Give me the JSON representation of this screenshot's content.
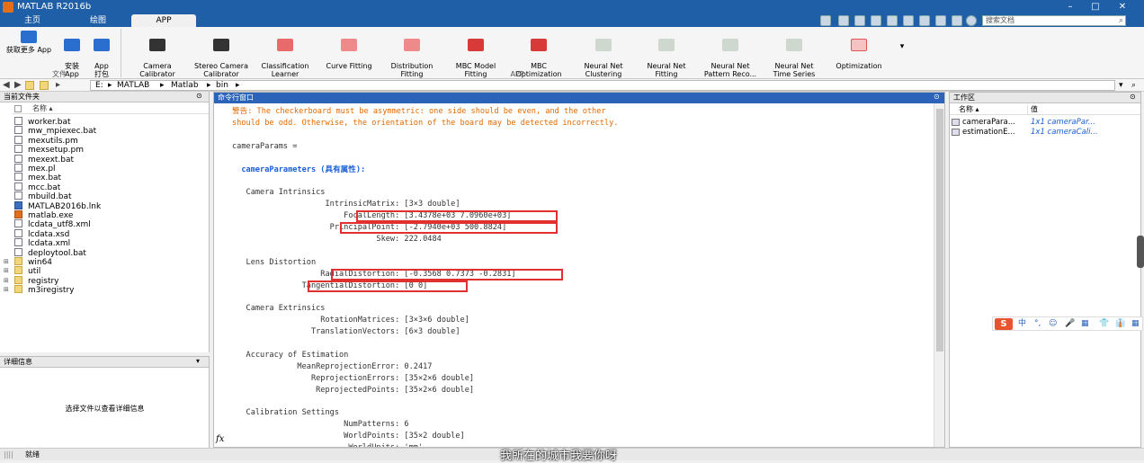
{
  "window": {
    "title": "MATLAB R2016b",
    "controls": [
      "–",
      "□",
      "✕"
    ]
  },
  "tabs": [
    {
      "label": "主页"
    },
    {
      "label": "绘图"
    },
    {
      "label": "APP"
    }
  ],
  "search": {
    "placeholder": "搜索文档"
  },
  "ribbon": {
    "file_group_label": "文件",
    "app_group_label": "APP",
    "file_buttons": [
      {
        "label": "获取更多 App"
      },
      {
        "label": "安装\nApp"
      },
      {
        "label": "App\n打包"
      }
    ],
    "apps": [
      {
        "label": "Camera\nCalibrator"
      },
      {
        "label": "Stereo Camera\nCalibrator"
      },
      {
        "label": "Classification\nLearner"
      },
      {
        "label": "Curve Fitting"
      },
      {
        "label": "Distribution\nFitting"
      },
      {
        "label": "MBC Model\nFitting"
      },
      {
        "label": "MBC\nOptimization"
      },
      {
        "label": "Neural Net\nClustering"
      },
      {
        "label": "Neural Net\nFitting"
      },
      {
        "label": "Neural Net\nPattern Reco..."
      },
      {
        "label": "Neural Net\nTime Series"
      },
      {
        "label": "Optimization"
      }
    ]
  },
  "address": {
    "path": [
      "E:",
      "MATLAB",
      "Matlab",
      "bin"
    ]
  },
  "current_folder": {
    "title": "当前文件夹",
    "col_name": "名称 ▴",
    "files": [
      {
        "name": "worker.bat",
        "type": "file"
      },
      {
        "name": "mw_mpiexec.bat",
        "type": "file"
      },
      {
        "name": "mexutils.pm",
        "type": "file"
      },
      {
        "name": "mexsetup.pm",
        "type": "file"
      },
      {
        "name": "mexext.bat",
        "type": "file"
      },
      {
        "name": "mex.pl",
        "type": "file"
      },
      {
        "name": "mex.bat",
        "type": "file"
      },
      {
        "name": "mcc.bat",
        "type": "file"
      },
      {
        "name": "mbuild.bat",
        "type": "file"
      },
      {
        "name": "MATLAB2016b.lnk",
        "type": "exe"
      },
      {
        "name": "matlab.exe",
        "type": "mat"
      },
      {
        "name": "lcdata_utf8.xml",
        "type": "file"
      },
      {
        "name": "lcdata.xsd",
        "type": "file"
      },
      {
        "name": "lcdata.xml",
        "type": "file"
      },
      {
        "name": "deploytool.bat",
        "type": "file"
      },
      {
        "name": "win64",
        "type": "folder"
      },
      {
        "name": "util",
        "type": "folder"
      },
      {
        "name": "registry",
        "type": "folder"
      },
      {
        "name": "m3iregistry",
        "type": "folder"
      }
    ]
  },
  "details": {
    "title": "详细信息",
    "message": "选择文件以查看详细信息"
  },
  "command_window": {
    "title": "命令行窗口",
    "lines": [
      {
        "text": "警告: The checkerboard must be asymmetric: one side should be even, and the other",
        "style": "warn"
      },
      {
        "text": "should be odd. Otherwise, the orientation of the board may be detected incorrectly.",
        "style": "warn"
      },
      {
        "text": "",
        "style": ""
      },
      {
        "text": "cameraParams =",
        "style": ""
      },
      {
        "text": "",
        "style": ""
      },
      {
        "text": "  cameraParameters (具有属性):",
        "style": "link"
      },
      {
        "text": "",
        "style": ""
      },
      {
        "text": "   Camera Intrinsics",
        "style": ""
      },
      {
        "text": "                    IntrinsicMatrix: [3×3 double]",
        "style": ""
      },
      {
        "text": "                        FocalLength: [3.4378e+03 7.0960e+03]",
        "style": ""
      },
      {
        "text": "                     PrincipalPoint: [-2.7940e+03 500.8824]",
        "style": ""
      },
      {
        "text": "                               Skew: 222.0484",
        "style": ""
      },
      {
        "text": "",
        "style": ""
      },
      {
        "text": "   Lens Distortion",
        "style": ""
      },
      {
        "text": "                   RadialDistortion: [-0.3568 0.7373 -0.2831]",
        "style": ""
      },
      {
        "text": "               TangentialDistortion: [0 0]",
        "style": ""
      },
      {
        "text": "",
        "style": ""
      },
      {
        "text": "   Camera Extrinsics",
        "style": ""
      },
      {
        "text": "                   RotationMatrices: [3×3×6 double]",
        "style": ""
      },
      {
        "text": "                 TranslationVectors: [6×3 double]",
        "style": ""
      },
      {
        "text": "",
        "style": ""
      },
      {
        "text": "   Accuracy of Estimation",
        "style": ""
      },
      {
        "text": "              MeanReprojectionError: 0.2417",
        "style": ""
      },
      {
        "text": "                 ReprojectionErrors: [35×2×6 double]",
        "style": ""
      },
      {
        "text": "                  ReprojectedPoints: [35×2×6 double]",
        "style": ""
      },
      {
        "text": "",
        "style": ""
      },
      {
        "text": "   Calibration Settings",
        "style": ""
      },
      {
        "text": "                        NumPatterns: 6",
        "style": ""
      },
      {
        "text": "                        WorldPoints: [35×2 double]",
        "style": ""
      },
      {
        "text": "                         WorldUnits: 'mm'",
        "style": ""
      }
    ],
    "prompt": "fx"
  },
  "workspace": {
    "title": "工作区",
    "col_name": "名称 ▴",
    "col_value": "值",
    "vars": [
      {
        "name": "cameraPara...",
        "value": "1x1 cameraPar..."
      },
      {
        "name": "estimationE...",
        "value": "1x1 cameraCali..."
      }
    ]
  },
  "ime": {
    "logo": "S",
    "items": [
      "中",
      "°,",
      "☺",
      "🎤",
      "▦",
      "👕",
      "👔",
      "▦"
    ]
  },
  "status": {
    "text": "就绪"
  },
  "subtitle": "我所在的城市我要你呀",
  "colors": {
    "titlebar": "#1f5fa8",
    "warning": "#e06a00",
    "link": "#1a5fd6",
    "highlight": "#e03030"
  }
}
